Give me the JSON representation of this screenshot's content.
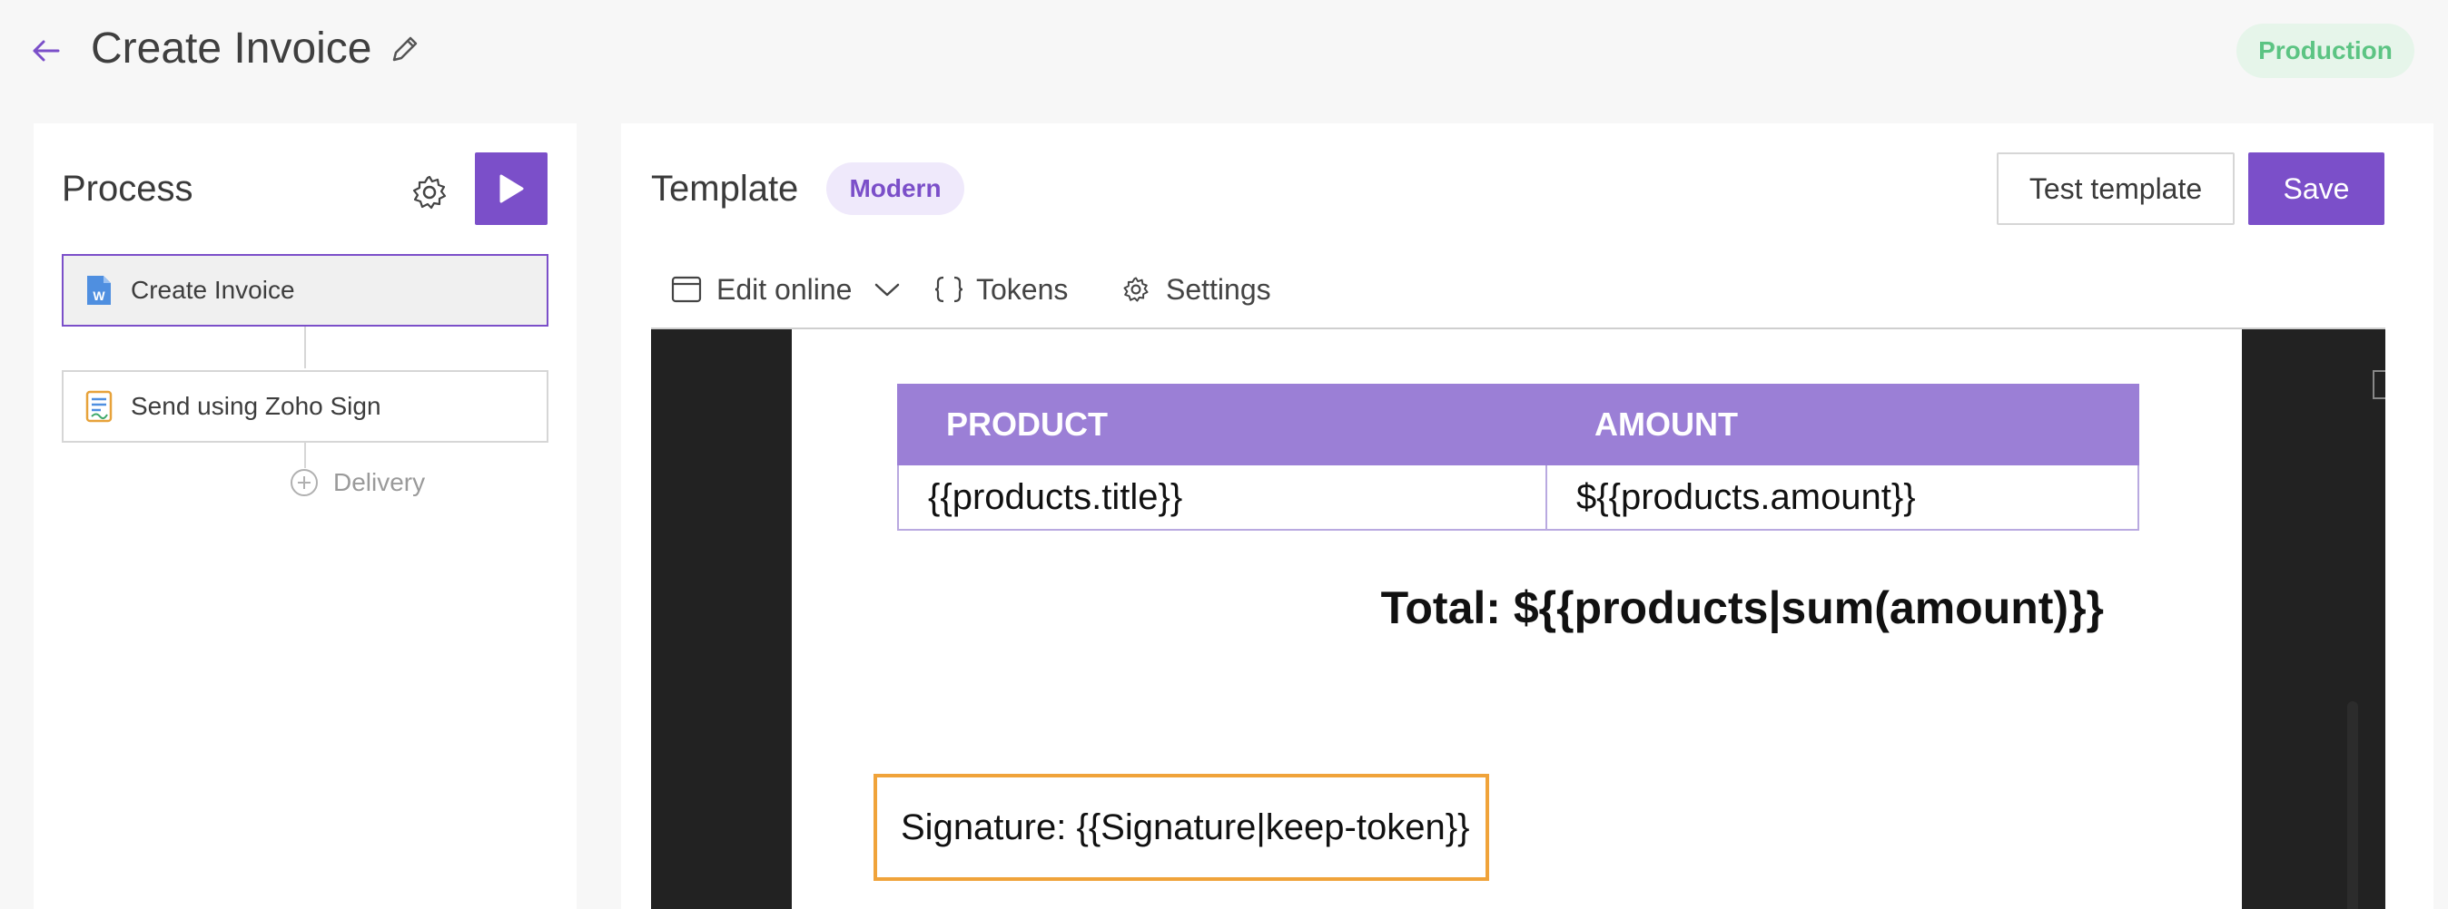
{
  "header": {
    "title": "Create Invoice",
    "environment": "Production",
    "back_icon": "arrow-left-icon",
    "edit_icon": "pencil-icon"
  },
  "process": {
    "title": "Process",
    "steps": [
      {
        "label": "Create Invoice",
        "icon": "word-doc-icon",
        "active": true
      },
      {
        "label": "Send using Zoho Sign",
        "icon": "zoho-sign-icon",
        "active": false
      }
    ],
    "add_delivery_label": "Delivery"
  },
  "template": {
    "title": "Template",
    "style_badge": "Modern",
    "test_button": "Test template",
    "save_button": "Save",
    "tabs": [
      {
        "label": "Edit online",
        "icon": "window-icon"
      },
      {
        "label": "Tokens",
        "icon": "braces-icon"
      },
      {
        "label": "Settings",
        "icon": "gear-icon"
      }
    ]
  },
  "document": {
    "table_headers": [
      "PRODUCT",
      "AMOUNT"
    ],
    "table_row": [
      "{{products.title}}",
      "${{products.amount}}"
    ],
    "total": "Total: ${{products|sum(amount)}}",
    "signature": "Signature: {{Signature|keep-token}}"
  },
  "colors": {
    "accent": "#7b4fc9",
    "table_header": "#9b7fd6",
    "signature_border": "#f0a33a",
    "production_badge_text": "#5cc483"
  }
}
